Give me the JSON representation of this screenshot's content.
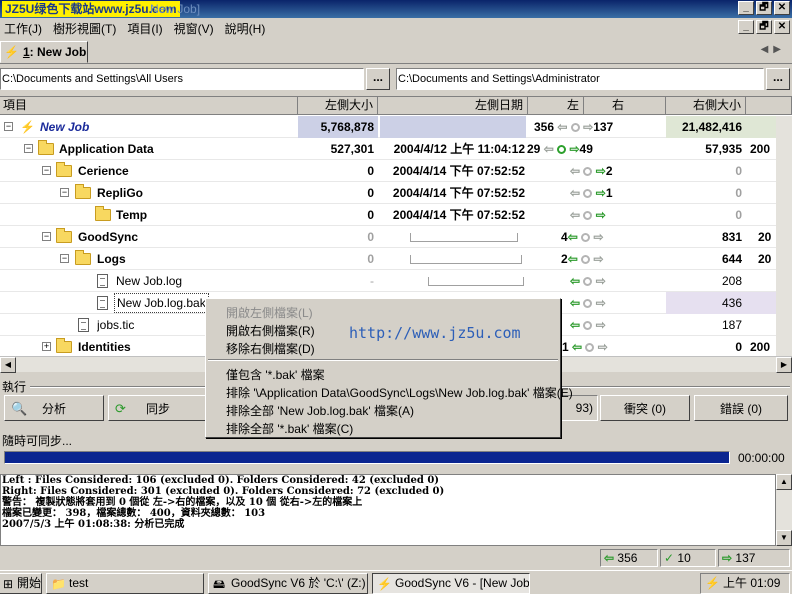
{
  "window": {
    "watermark": "JZ5U绿色下载站www.jz5u.com",
    "title_faint": "New Job]",
    "controls": [
      "_",
      "🗗",
      "✕"
    ]
  },
  "menu": [
    "工作(J)",
    "樹形視圖(T)",
    "項目(I)",
    "視窗(V)",
    "說明(H)"
  ],
  "tab": {
    "index": "1",
    "label": "New Job"
  },
  "paths": {
    "left": "C:\\Documents and Settings\\All Users",
    "right": "C:\\Documents and Settings\\Administrator",
    "browse": "..."
  },
  "columns": {
    "item": "項目",
    "left_size": "左側大小",
    "left_date": "左側日期",
    "left": "左",
    "right": "右",
    "right_size": "右側大小"
  },
  "rows": [
    {
      "name": "New Job",
      "left_size": "5,768,878",
      "left_date": "",
      "left_count": "356",
      "right_count": "137",
      "right_size": "21,482,416",
      "extra": ""
    },
    {
      "name": "Application Data",
      "left_size": "527,301",
      "left_date": "2004/4/12 上午 11:04:12",
      "left_count": "29",
      "right_count": "49",
      "right_size": "57,935",
      "extra": "200"
    },
    {
      "name": "Cerience",
      "left_size": "0",
      "left_date": "2004/4/14 下午 07:52:52",
      "left_count": "",
      "right_count": "2",
      "right_size": "0",
      "extra": ""
    },
    {
      "name": "RepliGo",
      "left_size": "0",
      "left_date": "2004/4/14 下午 07:52:52",
      "left_count": "",
      "right_count": "1",
      "right_size": "0",
      "extra": ""
    },
    {
      "name": "Temp",
      "left_size": "0",
      "left_date": "2004/4/14 下午 07:52:52",
      "left_count": "",
      "right_count": "",
      "right_size": "0",
      "extra": ""
    },
    {
      "name": "GoodSync",
      "left_size": "0",
      "left_date": "",
      "left_count": "4",
      "right_count": "",
      "right_size": "831",
      "extra": "20"
    },
    {
      "name": "Logs",
      "left_size": "0",
      "left_date": "",
      "left_count": "2",
      "right_count": "",
      "right_size": "644",
      "extra": "20"
    },
    {
      "name": "New Job.log",
      "left_size": "-",
      "left_date": "",
      "left_count": "",
      "right_count": "",
      "right_size": "208",
      "extra": ""
    },
    {
      "name": "New Job.log.bak",
      "left_size": "",
      "left_date": "",
      "left_count": "",
      "right_count": "",
      "right_size": "436",
      "extra": ""
    },
    {
      "name": "jobs.tic",
      "left_size": "",
      "left_date": "",
      "left_count": "",
      "right_count": "",
      "right_size": "187",
      "extra": ""
    },
    {
      "name": "Identities",
      "left_size": "",
      "left_date": "",
      "left_count": "1",
      "right_count": "",
      "right_size": "0",
      "extra": "200"
    }
  ],
  "context_menu": {
    "url": "http://www.jz5u.com",
    "items": [
      "開啟左側檔案(L)",
      "開啟右側檔案(R)",
      "移除右側檔案(D)",
      "僅包含 '*.bak' 檔案",
      "排除 '\\Application Data\\GoodSync\\Logs\\New Job.log.bak' 檔案(E)",
      "排除全部 'New Job.log.bak' 檔案(A)",
      "排除全部 '*.bak' 檔案(C)"
    ]
  },
  "exec": {
    "label": "執行",
    "analyze": "分析",
    "sync": "同步",
    "partial": "93)",
    "conflict": "衝突 (0)",
    "error": "錯誤 (0)"
  },
  "status_text": "隨時可同步...",
  "progress": {
    "fraction": 1.0,
    "time": "00:00:00"
  },
  "log_lines": [
    "Left : Files Considered: 106 (excluded 0). Folders Considered: 42 (excluded 0)",
    "Right: Files Considered: 301 (excluded 0). Folders Considered: 72 (excluded 0)",
    "警告： 複製狀態將套用到 0 個從 左->右的檔案，以及 10 個 從右->左的檔案上",
    "檔案已變更： 398，檔案總數： 400，資料夾總數： 103",
    "2007/5/3 上午 01:08:38: 分析已完成"
  ],
  "statusbar": {
    "left": "356",
    "check": "10",
    "right": "137"
  },
  "taskbar": {
    "start": "開始",
    "items": [
      "test",
      "GoodSync V6 於 'C:\\' (Z:)",
      "GoodSync V6 - [New Job]"
    ],
    "clock": "上午 01:09"
  },
  "colors": {
    "accent": "#0a246a",
    "progress": "#0a2590",
    "arrow_green": "#2c9a2c",
    "url_blue": "#2d5fb8"
  }
}
